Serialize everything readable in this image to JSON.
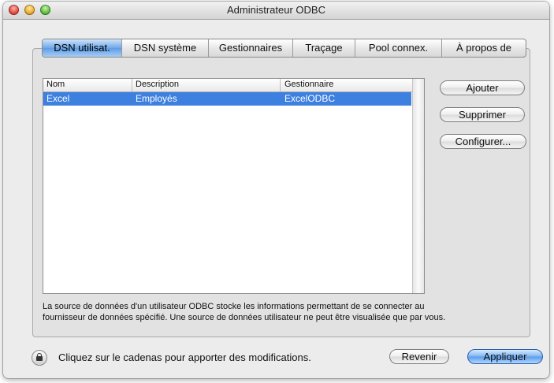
{
  "window": {
    "title": "Administrateur ODBC"
  },
  "tabs": [
    {
      "label": "DSN utilisat.",
      "active": true
    },
    {
      "label": "DSN système",
      "active": false
    },
    {
      "label": "Gestionnaires",
      "active": false
    },
    {
      "label": "Traçage",
      "active": false
    },
    {
      "label": "Pool connex.",
      "active": false
    },
    {
      "label": "À propos de",
      "active": false
    }
  ],
  "table": {
    "columns": [
      "Nom",
      "Description",
      "Gestionnaire"
    ],
    "rows": [
      {
        "name": "Excel",
        "description": "Employés",
        "driver": "ExcelODBC",
        "selected": true
      }
    ]
  },
  "buttons": {
    "add": "Ajouter",
    "remove": "Supprimer",
    "configure": "Configurer...",
    "revert": "Revenir",
    "apply": "Appliquer"
  },
  "description": "La source de données d'un utilisateur ODBC stocke les informations permettant de se connecter au fournisseur de données spécifié. Une source de données utilisateur ne peut être visualisée que par vous.",
  "lock": {
    "text": "Cliquez sur le cadenas pour apporter des modifications."
  },
  "colors": {
    "selection": "#3d80df",
    "accent": "#5f9ce4"
  }
}
